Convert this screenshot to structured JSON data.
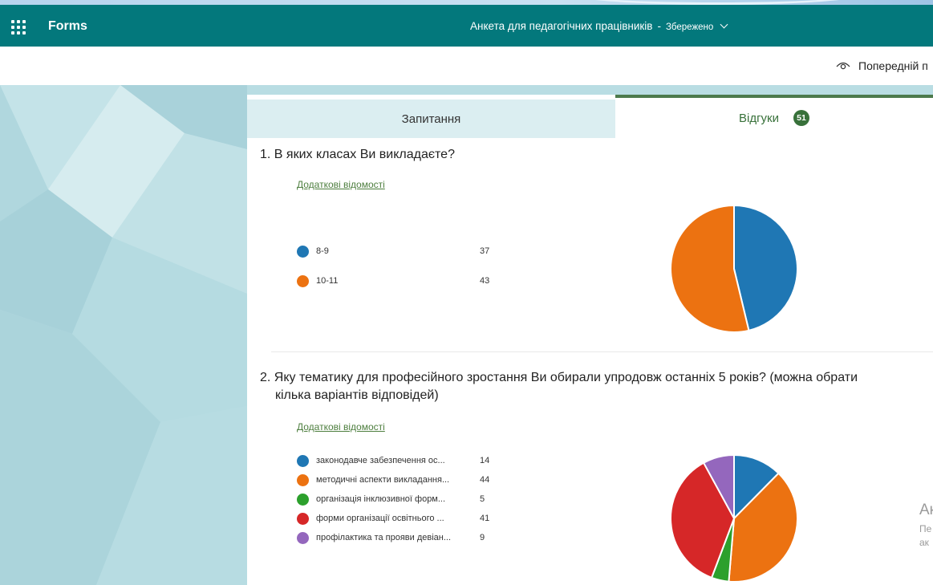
{
  "topbar": {
    "app_name": "Forms",
    "form_title": "Анкета для педагогічних працівників",
    "separator": "-",
    "save_status": "Збережено"
  },
  "commandbar": {
    "preview_label": "Попередній п"
  },
  "tabs": [
    {
      "label": "Запитання",
      "active": false
    },
    {
      "label": "Відгуки",
      "active": true,
      "count": "51"
    }
  ],
  "questions": [
    {
      "title": "1. В яких класах Ви викладаєте?",
      "link": "Додаткові відомості",
      "chart_data": {
        "type": "pie",
        "categories": [
          "8-9",
          "10-11"
        ],
        "values": [
          37,
          43
        ],
        "colors": [
          "#1f77b4",
          "#ec7211"
        ]
      }
    },
    {
      "title_line1": "2. Яку тематику для професійного зростання Ви обирали упродовж останніх 5 років? (можна обрати",
      "title_line2": "кілька варіантів відповідей)",
      "link": "Додаткові відомості",
      "chart_data": {
        "type": "pie",
        "categories": [
          "законодавче забезпечення ос...",
          "методичні аспекти викладання...",
          "організація інклюзивної форм...",
          "форми організації освітнього ...",
          "профілактика та прояви девіан..."
        ],
        "values": [
          14,
          44,
          5,
          41,
          9
        ],
        "colors": [
          "#1f77b4",
          "#ec7211",
          "#2ca02c",
          "#d62728",
          "#9467bd"
        ]
      }
    }
  ],
  "watermark": {
    "line1": "Ак",
    "line2": "Пе",
    "line3": "ак"
  },
  "colors": {
    "header": "#03787c",
    "accent_green": "#38713a",
    "background": "#b9dde3"
  }
}
